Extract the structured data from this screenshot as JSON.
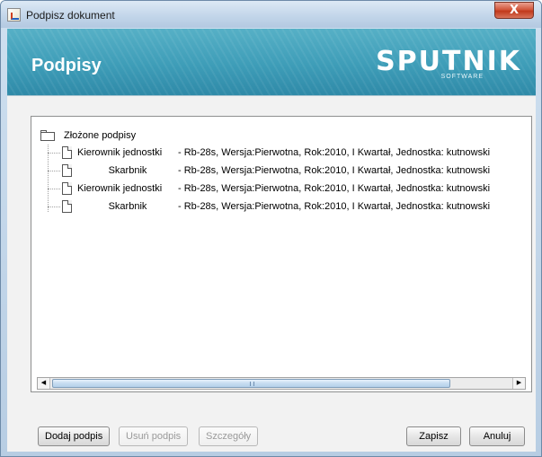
{
  "window": {
    "title": "Podpisz dokument",
    "close_glyph": "X"
  },
  "banner": {
    "title": "Podpisy",
    "logo_text": "Sputnik",
    "logo_sub": "SOFTWARE"
  },
  "tree": {
    "root_label": "Złożone podpisy",
    "items": [
      {
        "role": "Kierownik jednostki",
        "details": "- Rb-28s, Wersja:Pierwotna, Rok:2010, I Kwartał, Jednostka: kutnowski"
      },
      {
        "role": "Skarbnik",
        "details": "- Rb-28s, Wersja:Pierwotna, Rok:2010, I Kwartał, Jednostka: kutnowski"
      },
      {
        "role": "Kierownik jednostki",
        "details": "- Rb-28s, Wersja:Pierwotna, Rok:2010, I Kwartał, Jednostka: kutnowski"
      },
      {
        "role": "Skarbnik",
        "details": "- Rb-28s, Wersja:Pierwotna, Rok:2010, I Kwartał, Jednostka: kutnowski"
      }
    ]
  },
  "scrollbar": {
    "left_arrow": "◀",
    "right_arrow": "▶",
    "grip": "|||"
  },
  "buttons": {
    "add_signature": "Dodaj podpis",
    "remove_signature": "Usuń podpis",
    "details": "Szczegóły",
    "save": "Zapisz",
    "cancel": "Anuluj"
  },
  "icons": {
    "window_icon": "java-app-icon",
    "root_icon": "folder-icon",
    "item_icon": "document-icon"
  }
}
